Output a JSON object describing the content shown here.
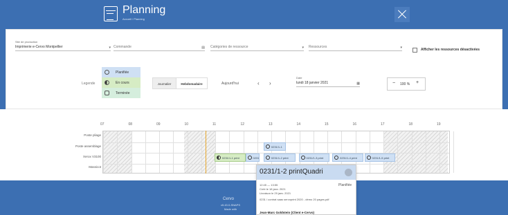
{
  "header": {
    "title": "Planning",
    "breadcrumb": "Accueil / Planning"
  },
  "filters": {
    "site_label": "Site de production",
    "site_value": "Imprimerie e-Cervo Montpellier",
    "commande_placeholder": "Commande",
    "categories_placeholder": "Catégories de ressource",
    "ressources_placeholder": "Ressources",
    "show_disabled_label": "Afficher les ressources désactivées"
  },
  "legend": {
    "title": "Legende",
    "items": [
      {
        "label": "Planifiée",
        "color": "#cfe0f4"
      },
      {
        "label": "En cours",
        "color": "#d6ecc4"
      },
      {
        "label": "Terminée",
        "color": "#d5eedd"
      }
    ]
  },
  "view": {
    "journalier": "Journalier",
    "hebdomadaire": "Hebdomadaire",
    "today": "Aujourd'hui",
    "prev": "‹",
    "next": "›",
    "date_label": "Date",
    "date_value": "lundi 18 janvier 2021",
    "zoom_minus": "−",
    "zoom_value": "100 %",
    "zoom_plus": "+"
  },
  "timeline": {
    "hours": [
      "07",
      "08",
      "09",
      "10",
      "11",
      "12",
      "13",
      "14",
      "15",
      "16",
      "17",
      "18",
      "19"
    ],
    "rows": [
      "Poste pliage",
      "Poste assemblage",
      "Xerox V3100",
      "Massicot"
    ],
    "events": [
      {
        "label": "0231/1-1 print",
        "status": "en-cours",
        "row": 2,
        "start_hour": 11.0,
        "end_hour": 12.1
      },
      {
        "label": "0231/1",
        "status": "planifiee",
        "row": 2,
        "start_hour": 12.1,
        "end_hour": 12.6
      },
      {
        "label": "0231/1-2 print",
        "status": "planifiee",
        "row": 2,
        "start_hour": 12.75,
        "end_hour": 13.9
      },
      {
        "label": "0231/1-3 print",
        "status": "planifiee",
        "row": 2,
        "start_hour": 14.0,
        "end_hour": 15.1
      },
      {
        "label": "0231/1-4 print",
        "status": "planifiee",
        "row": 2,
        "start_hour": 15.2,
        "end_hour": 16.3
      },
      {
        "label": "0231/1-5 print",
        "status": "planifiee",
        "row": 2,
        "start_hour": 16.35,
        "end_hour": 17.45
      },
      {
        "label": "0231/1-1",
        "status": "planifiee",
        "row": 1,
        "start_hour": 12.75,
        "end_hour": 13.55
      }
    ]
  },
  "tooltip": {
    "title": "0231/1-2 printQuadri",
    "time": "12:45 — 13:55",
    "status": "Planifiée",
    "created": "Créé le 18 janv. 2021",
    "delivery": "Livraison le 29 janv. 2021",
    "file": "0231 / contrat saas servoprint 2020 - démo 20 pages.pdf",
    "author": "Jean-Marc Goldstein (Client e-Cervo)"
  },
  "footer": {
    "brand": "Cervo",
    "version": "v5.43.0-SNAPS",
    "made_with": "Made with"
  }
}
